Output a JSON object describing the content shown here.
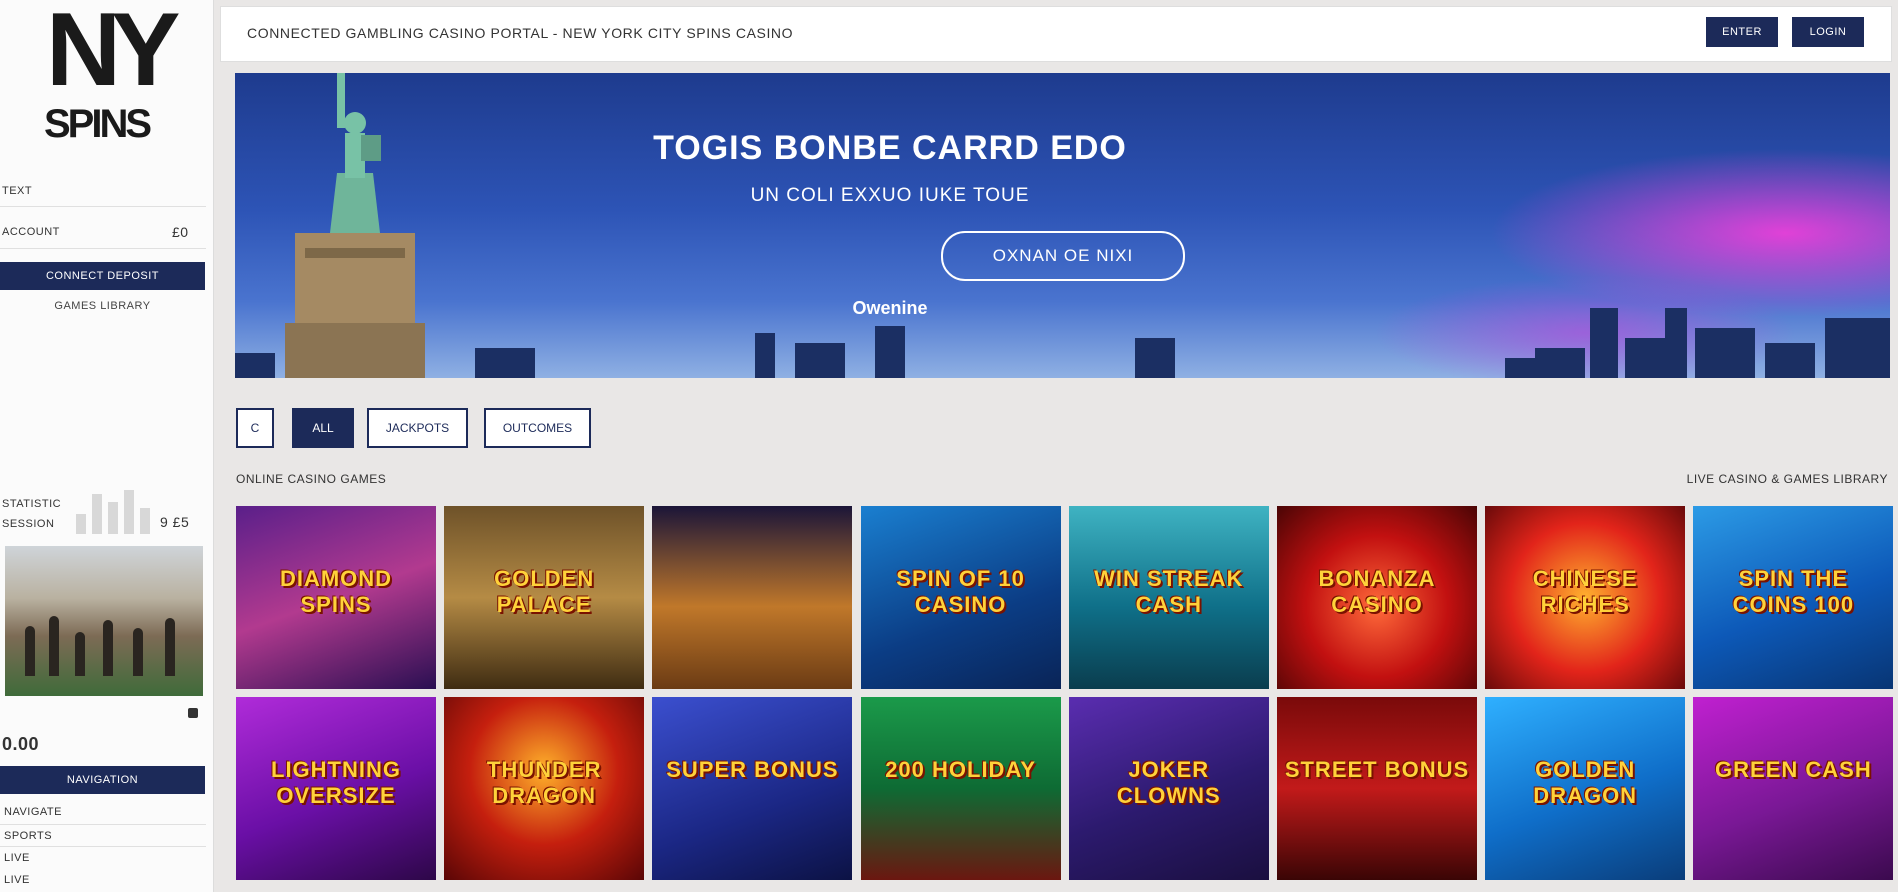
{
  "sidebar": {
    "logo_top": "NY",
    "logo_bottom": "SPINS",
    "label_1": "TEXT",
    "label_2": "ACCOUNT",
    "label_2_value": "£0",
    "primary_button": "CONNECT DEPOSIT",
    "secondary_link": "GAMES LIBRARY",
    "stats_label_1": "STATISTIC",
    "stats_label_2": "SESSION",
    "stats_value": "9 £5",
    "balance": "0.00",
    "balance_sub": "",
    "nav_button": "NAVIGATION",
    "nav_items": [
      "NAVIGATE",
      "SPORTS",
      "LIVE",
      "LIVE"
    ]
  },
  "topbar": {
    "title": "CONNECTED GAMBLING CASINO PORTAL - NEW YORK CITY SPINS CASINO",
    "button_1": "ENTER",
    "button_2": "LOGIN"
  },
  "hero": {
    "title": "TOGIS BONBE CARRD EDO",
    "subtitle": "UN COLI EXXUO IUKE TOUE",
    "button": "OXNAN OE NIXI",
    "link": "Owenine"
  },
  "filters": {
    "icon_label": "C",
    "items": [
      "ALL",
      "JACKPOTS",
      "OUTCOMES"
    ]
  },
  "section": {
    "left_title": "ONLINE CASINO GAMES",
    "right_title": "LIVE CASINO & GAMES LIBRARY"
  },
  "games": [
    {
      "name": "DIAMOND SPINS"
    },
    {
      "name": "GOLDEN PALACE"
    },
    {
      "name": ""
    },
    {
      "name": "SPIN OF 10 CASINO"
    },
    {
      "name": "WIN STREAK CASH"
    },
    {
      "name": "BONANZA CASINO"
    },
    {
      "name": "CHINESE RICHES"
    },
    {
      "name": "SPIN THE COINS 100"
    },
    {
      "name": "LIGHTNING OVERSIZE"
    },
    {
      "name": "THUNDER DRAGON"
    },
    {
      "name": "SUPER BONUS"
    },
    {
      "name": "200 HOLIDAY"
    },
    {
      "name": "JOKER CLOWNS"
    },
    {
      "name": "STREET BONUS"
    },
    {
      "name": "GOLDEN DRAGON"
    },
    {
      "name": "GREEN CASH"
    }
  ],
  "colors": {
    "navy": "#1c2a59",
    "page_bg": "#e9e7e6",
    "hero_sky": "#2d54b6",
    "hero_glow": "#ff3cdc"
  }
}
